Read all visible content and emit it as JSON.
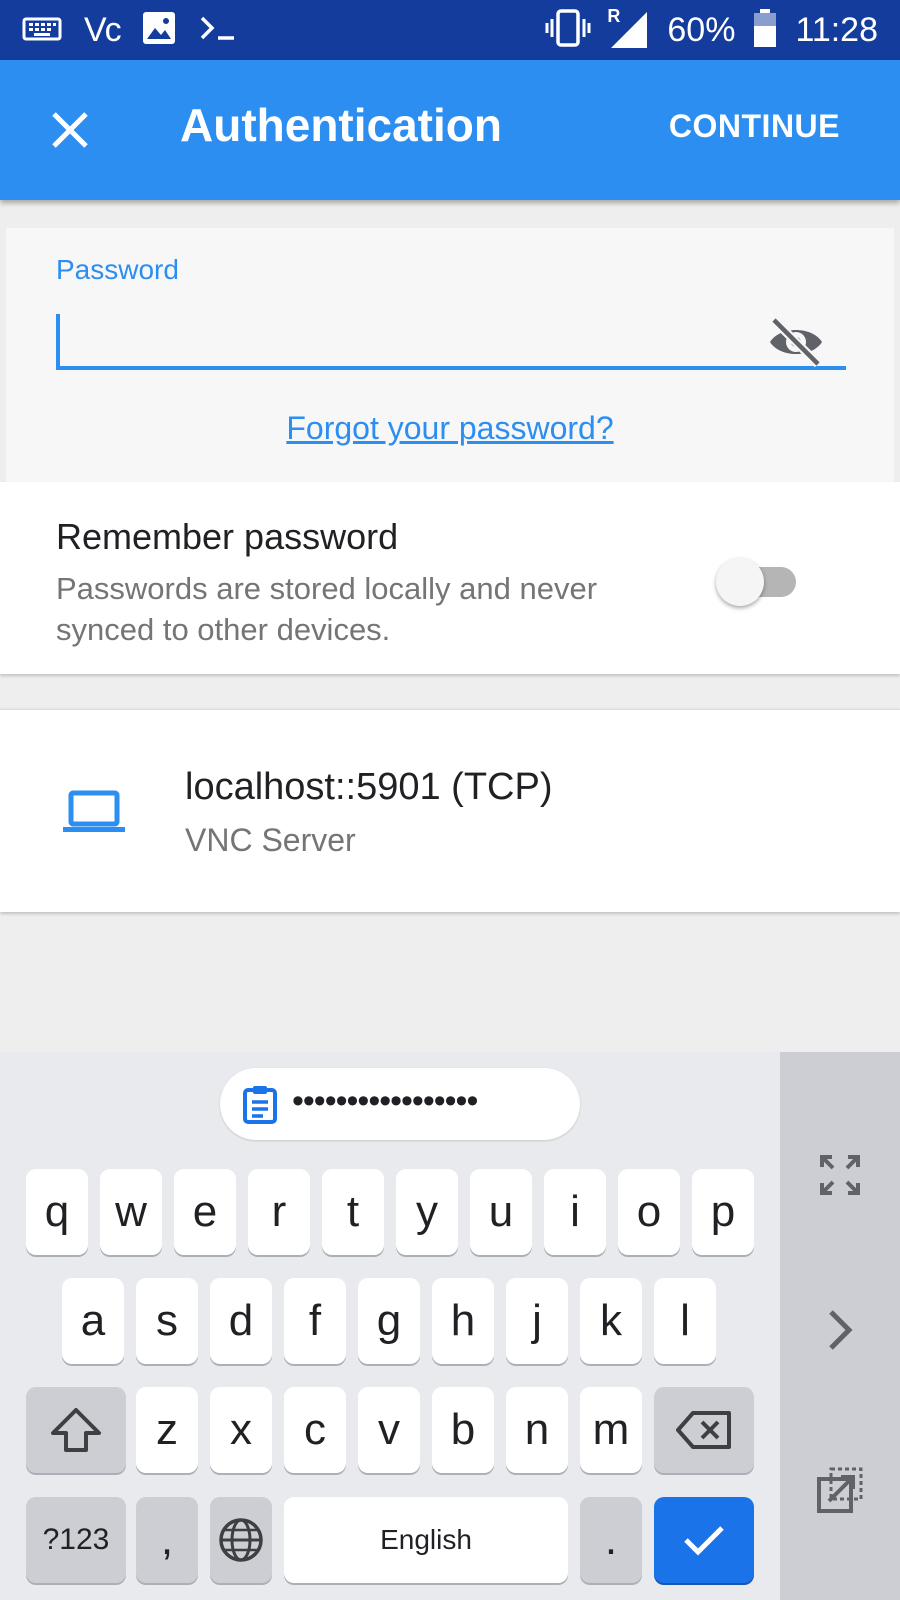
{
  "status_bar": {
    "vnc_text": "Vc",
    "battery": "60%",
    "time": "11:28",
    "roaming": "R"
  },
  "app_bar": {
    "title": "Authentication",
    "continue_label": "CONTINUE"
  },
  "password_card": {
    "label": "Password",
    "value": "",
    "forgot_link": "Forgot your password?"
  },
  "remember": {
    "title": "Remember password",
    "description": "Passwords are stored locally and never synced to other devices.",
    "enabled": false
  },
  "server": {
    "name": "localhost::5901 (TCP)",
    "type": "VNC Server"
  },
  "keyboard": {
    "suggestion": "•••••••••••••••••",
    "row1": [
      "q",
      "w",
      "e",
      "r",
      "t",
      "y",
      "u",
      "i",
      "o",
      "p"
    ],
    "row2": [
      "a",
      "s",
      "d",
      "f",
      "g",
      "h",
      "j",
      "k",
      "l"
    ],
    "row3": [
      "z",
      "x",
      "c",
      "v",
      "b",
      "n",
      "m"
    ],
    "symbols_label": "?123",
    "comma_label": ",",
    "space_label": "English",
    "period_label": "."
  },
  "colors": {
    "accent": "#2b8ef0",
    "status_bar": "#133c9c",
    "enter_key": "#1a73e8"
  }
}
